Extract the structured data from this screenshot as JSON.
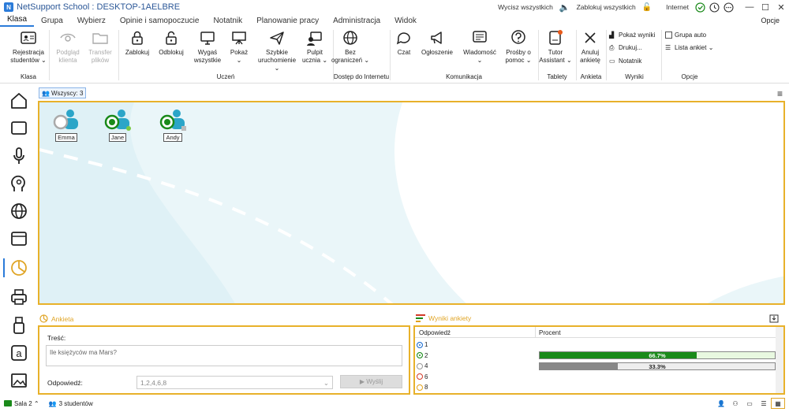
{
  "window": {
    "title": "NetSupport School : DESKTOP-1AELBRE"
  },
  "titlebar": {
    "clear_all": "Wycisz wszystkich",
    "lock_all": "Zablokuj wszystkich",
    "internet": "Internet"
  },
  "menu": {
    "items": [
      "Klasa",
      "Grupa",
      "Wybierz",
      "Opinie i samopoczucie",
      "Notatnik",
      "Planowanie pracy",
      "Administracja",
      "Widok"
    ],
    "active": "Klasa",
    "options": "Opcje"
  },
  "ribbon": {
    "buttons": {
      "rejestracja": "Rejestracja\nstudentów ⌄",
      "podglad": "Podgląd\nklienta",
      "transfer": "Transfer\nplików",
      "zablokuj": "Zablokuj",
      "odblokuj": "Odblokuj",
      "wygas": "Wygaś\nwszystkie",
      "pokaz": "Pokaż\n⌄",
      "szybkie": "Szybkie\nuruchomienie ⌄",
      "pulpit": "Pulpit\nucznia ⌄",
      "bez": "Bez\nograniczeń ⌄",
      "czat": "Czat",
      "ogloszenie": "Ogłoszenie",
      "wiadomosc": "Wiadomość\n⌄",
      "prosby": "Prośby o\npomoc ⌄",
      "tutor": "Tutor\nAssistant ⌄",
      "anuluj": "Anuluj\nankietę"
    },
    "small": {
      "pokaz_wyniki": "Pokaż wyniki",
      "drukuj": "Drukuj...",
      "notatnik": "Notatnik",
      "grupa_auto": "Grupa auto",
      "lista_ankiet": "Lista ankiet  ⌄"
    },
    "groups": {
      "klasa": "Klasa",
      "uczen": "Uczeń",
      "dostep": "Dostęp do Internetu",
      "komunikacja": "Komunikacja",
      "tablety": "Tablety",
      "ankieta": "Ankieta",
      "wyniki": "Wyniki",
      "opcje": "Opcje"
    }
  },
  "filter": {
    "label": "Wszyscy: 3"
  },
  "students": [
    {
      "name": "Emma",
      "status_color": "#aaaaaa"
    },
    {
      "name": "Jane",
      "status_color": "#1a8a1a"
    },
    {
      "name": "Andy",
      "status_color": "#1a8a1a"
    }
  ],
  "survey": {
    "title": "Ankieta",
    "content_label": "Treść:",
    "question": "Ile księżyców ma Mars?",
    "answers_label": "Odpowiedź:",
    "answers": "1,2,4,6,8",
    "send_label": "▶ Wyślij"
  },
  "results": {
    "title": "Wyniki ankiety",
    "col_answer": "Odpowiedź",
    "col_percent": "Procent",
    "rows": [
      {
        "answer": "1",
        "color": "#1f6fd1",
        "percent": null,
        "percent_label": ""
      },
      {
        "answer": "2",
        "color": "#1a8a1a",
        "percent": 66.7,
        "percent_label": "66.7%"
      },
      {
        "answer": "4",
        "color": "#999999",
        "percent": 33.3,
        "percent_label": "33.3%"
      },
      {
        "answer": "6",
        "color": "#d43b2a",
        "percent": null,
        "percent_label": ""
      },
      {
        "answer": "8",
        "color": "#e3a21a",
        "percent": null,
        "percent_label": ""
      }
    ]
  },
  "status": {
    "room": "Sala 2 ⌃",
    "students": "3 studentów"
  }
}
